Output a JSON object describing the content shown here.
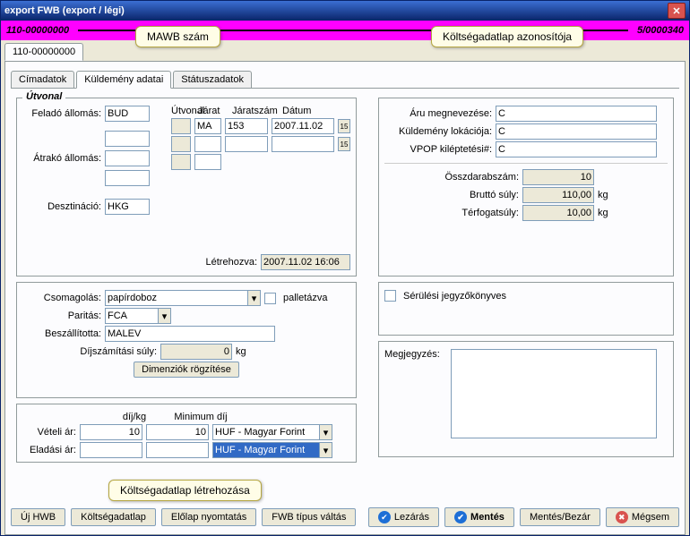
{
  "window": {
    "title": "export FWB (export / légi)"
  },
  "header": {
    "mawb": "110-00000000",
    "costsheet_id": "5/0000340"
  },
  "callouts": {
    "mawb_label": "MAWB szám",
    "costsheet_label": "Költségadatlap azonosítója",
    "create_btn_label": "Költségadatlap létrehozása"
  },
  "outer_tab": "110-00000000",
  "subtabs": [
    "Címadatok",
    "Küldemény adatai",
    "Státuszadatok"
  ],
  "utvonal": {
    "title": "Útvonal",
    "felado_label": "Feladó állomás:",
    "atrako_label": "Átrakó állomás:",
    "deszt_label": "Desztináció:",
    "felado": "BUD",
    "atrako1": "",
    "atrako2": "",
    "atrako3": "",
    "deszt": "HKG",
    "jarat_lbl": "Járat",
    "jaratszam_lbl": "Járatszám",
    "datum_lbl": "Dátum",
    "utvonal_lbl": "Útvonal",
    "jarat": "MA",
    "jaratszam": "153",
    "datum": "2007.11.02",
    "letrehozva_lbl": "Létrehozva:",
    "letrehozva": "2007.11.02 16:06"
  },
  "csom": {
    "csomagolas_lbl": "Csomagolás:",
    "csomagolas": "papírdoboz",
    "pallet_lbl": "palletázva",
    "paritas_lbl": "Paritás:",
    "paritas": "FCA",
    "beszall_lbl": "Beszállította:",
    "beszall": "MALEV",
    "dijsuly_lbl": "Díjszámítási súly:",
    "dijsuly": "0",
    "kg": "kg",
    "dim_btn": "Dimenziók rögzítése"
  },
  "arak": {
    "dijkg_lbl": "díj/kg",
    "min_lbl": "Minimum díj",
    "veteli_lbl": "Vételi ár:",
    "eladasi_lbl": "Eladási ár:",
    "veteli_dij": "10",
    "veteli_min": "10",
    "huf": "HUF - Magyar Forint"
  },
  "right": {
    "aru_lbl": "Áru megnevezése:",
    "aru": "C",
    "lok_lbl": "Küldemény lokációja:",
    "lok": "C",
    "vpop_lbl": "VPOP kiléptetési#:",
    "vpop": "C",
    "darab_lbl": "Összdarabszám:",
    "darab": "10",
    "brutto_lbl": "Bruttó súly:",
    "brutto": "110,00",
    "kg": "kg",
    "terf_lbl": "Térfogatsúly:",
    "terf": "10,00",
    "serules_lbl": "Sérülési jegyzőkönyves",
    "megj_lbl": "Megjegyzés:"
  },
  "buttons": {
    "uj_hwb": "Új HWB",
    "koltseg": "Költségadatlap",
    "elolap": "Előlap nyomtatás",
    "fwb": "FWB típus váltás",
    "lezaras": "Lezárás",
    "mentes": "Mentés",
    "mentesbezar": "Mentés/Bezár",
    "megsem": "Mégsem"
  }
}
